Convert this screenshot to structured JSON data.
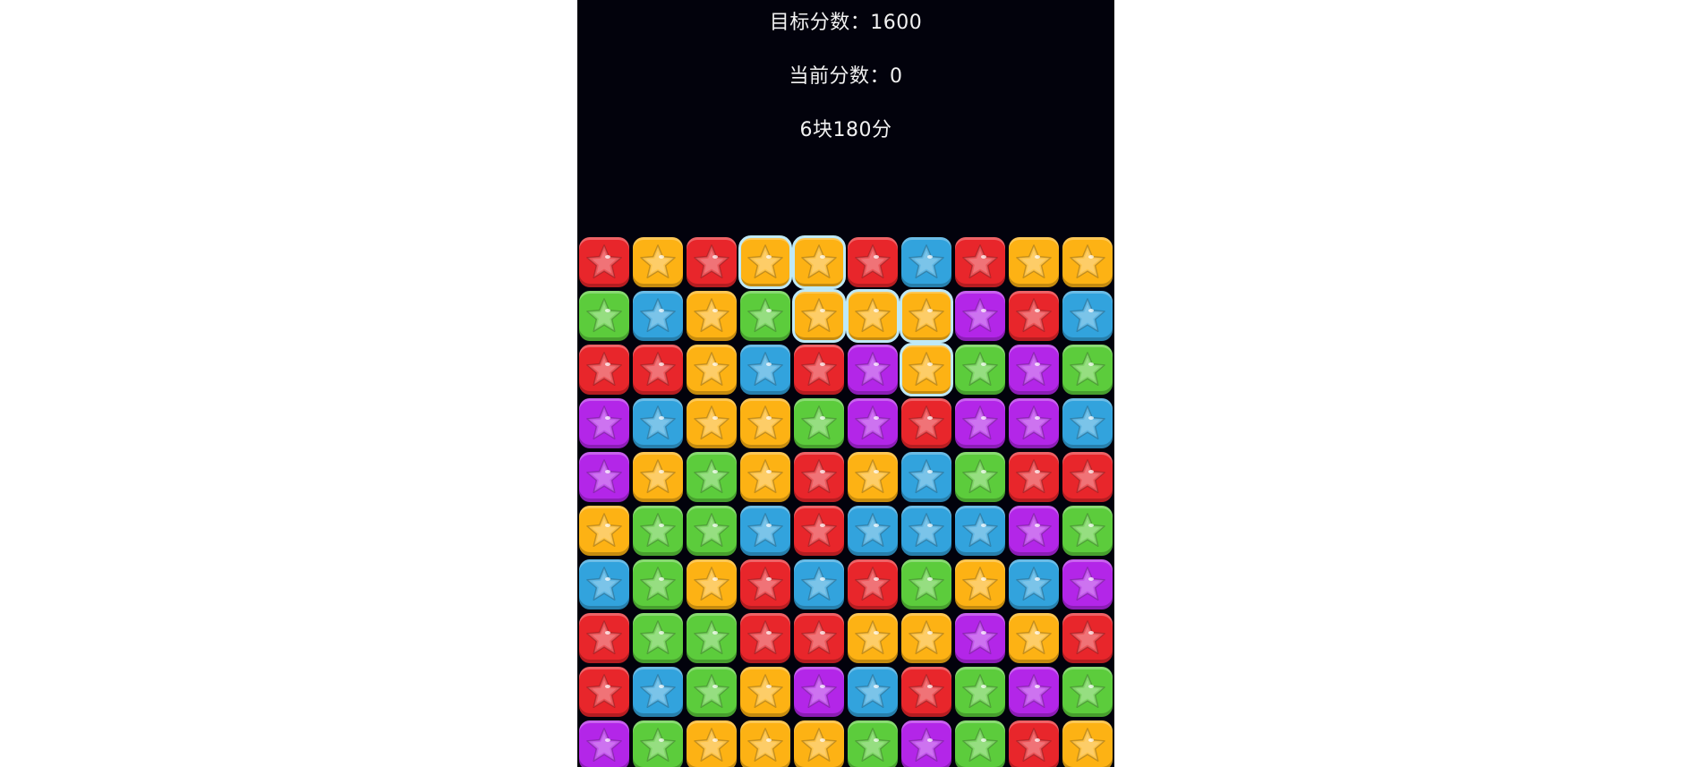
{
  "header": {
    "target_score": "目标分数：1600",
    "current_score": "当前分数：0",
    "selection_hint": "6块180分"
  },
  "colors": {
    "R": "#e8262b",
    "Y": "#fdb214",
    "B": "#32a3dd",
    "G": "#5ccc3c",
    "P": "#b326e8"
  },
  "board": {
    "icon": "star-icon",
    "grid": [
      [
        "R",
        "Y",
        "R",
        "Y",
        "Y",
        "R",
        "B",
        "R",
        "Y",
        "Y"
      ],
      [
        "G",
        "B",
        "Y",
        "G",
        "Y",
        "Y",
        "Y",
        "P",
        "R",
        "B"
      ],
      [
        "R",
        "R",
        "Y",
        "B",
        "R",
        "P",
        "Y",
        "G",
        "P",
        "G"
      ],
      [
        "P",
        "B",
        "Y",
        "Y",
        "G",
        "P",
        "R",
        "P",
        "P",
        "B"
      ],
      [
        "P",
        "Y",
        "G",
        "Y",
        "R",
        "Y",
        "B",
        "G",
        "R",
        "R"
      ],
      [
        "Y",
        "G",
        "G",
        "B",
        "R",
        "B",
        "B",
        "B",
        "P",
        "G"
      ],
      [
        "B",
        "G",
        "Y",
        "R",
        "B",
        "R",
        "G",
        "Y",
        "B",
        "P"
      ],
      [
        "R",
        "G",
        "G",
        "R",
        "R",
        "Y",
        "Y",
        "P",
        "Y",
        "R"
      ],
      [
        "R",
        "B",
        "G",
        "Y",
        "P",
        "B",
        "R",
        "G",
        "P",
        "G"
      ],
      [
        "P",
        "G",
        "Y",
        "Y",
        "Y",
        "G",
        "P",
        "G",
        "R",
        "Y"
      ]
    ],
    "selected_cells": [
      [
        0,
        3
      ],
      [
        0,
        4
      ],
      [
        1,
        4
      ],
      [
        1,
        5
      ],
      [
        1,
        6
      ],
      [
        2,
        6
      ]
    ]
  }
}
